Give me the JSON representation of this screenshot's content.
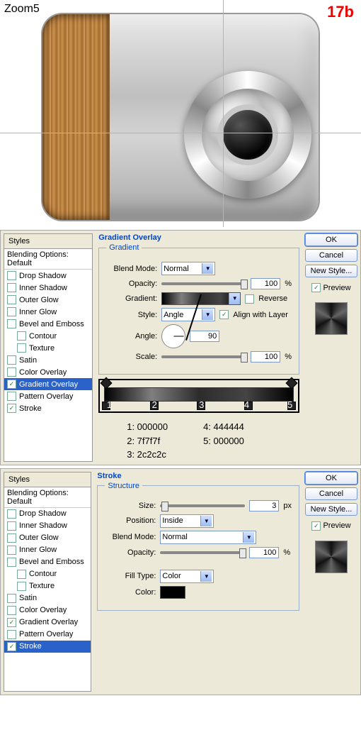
{
  "header": {
    "zoom": "Zoom5",
    "step": "17b"
  },
  "panels": [
    {
      "styles_title": "Styles",
      "blending_options": "Blending Options: Default",
      "style_list": [
        {
          "label": "Drop Shadow",
          "checked": false,
          "indent": false
        },
        {
          "label": "Inner Shadow",
          "checked": false,
          "indent": false
        },
        {
          "label": "Outer Glow",
          "checked": false,
          "indent": false
        },
        {
          "label": "Inner Glow",
          "checked": false,
          "indent": false
        },
        {
          "label": "Bevel and Emboss",
          "checked": false,
          "indent": false
        },
        {
          "label": "Contour",
          "checked": false,
          "indent": true
        },
        {
          "label": "Texture",
          "checked": false,
          "indent": true
        },
        {
          "label": "Satin",
          "checked": false,
          "indent": false
        },
        {
          "label": "Color Overlay",
          "checked": false,
          "indent": false
        },
        {
          "label": "Gradient Overlay",
          "checked": true,
          "indent": false,
          "selected": true
        },
        {
          "label": "Pattern Overlay",
          "checked": false,
          "indent": false
        },
        {
          "label": "Stroke",
          "checked": true,
          "indent": false
        }
      ],
      "section": "Gradient Overlay",
      "group": "Gradient",
      "fields": {
        "blend_mode_label": "Blend Mode:",
        "blend_mode": "Normal",
        "opacity_label": "Opacity:",
        "opacity": "100",
        "pct": "%",
        "gradient_label": "Gradient:",
        "reverse_label": "Reverse",
        "style_label": "Style:",
        "style": "Angle",
        "align_label": "Align with Layer",
        "angle_label": "Angle:",
        "angle": "90",
        "scale_label": "Scale:",
        "scale": "100"
      },
      "editor_numbers": [
        "1",
        "2",
        "3",
        "4",
        "5"
      ],
      "stop_colors": {
        "s1": "1: 000000",
        "s2": "2: 7f7f7f",
        "s3": "3: 2c2c2c",
        "s4": "4: 444444",
        "s5": "5: 000000"
      },
      "buttons": {
        "ok": "OK",
        "cancel": "Cancel",
        "new_style": "New Style...",
        "preview": "Preview"
      }
    },
    {
      "styles_title": "Styles",
      "blending_options": "Blending Options: Default",
      "style_list": [
        {
          "label": "Drop Shadow",
          "checked": false,
          "indent": false
        },
        {
          "label": "Inner Shadow",
          "checked": false,
          "indent": false
        },
        {
          "label": "Outer Glow",
          "checked": false,
          "indent": false
        },
        {
          "label": "Inner Glow",
          "checked": false,
          "indent": false
        },
        {
          "label": "Bevel and Emboss",
          "checked": false,
          "indent": false
        },
        {
          "label": "Contour",
          "checked": false,
          "indent": true
        },
        {
          "label": "Texture",
          "checked": false,
          "indent": true
        },
        {
          "label": "Satin",
          "checked": false,
          "indent": false
        },
        {
          "label": "Color Overlay",
          "checked": false,
          "indent": false
        },
        {
          "label": "Gradient Overlay",
          "checked": true,
          "indent": false
        },
        {
          "label": "Pattern Overlay",
          "checked": false,
          "indent": false
        },
        {
          "label": "Stroke",
          "checked": true,
          "indent": false,
          "selected": true
        }
      ],
      "section": "Stroke",
      "group": "Structure",
      "fields": {
        "size_label": "Size:",
        "size": "3",
        "px": "px",
        "position_label": "Position:",
        "position": "Inside",
        "blend_mode_label": "Blend Mode:",
        "blend_mode": "Normal",
        "opacity_label": "Opacity:",
        "opacity": "100",
        "pct": "%",
        "filltype_label": "Fill Type:",
        "filltype": "Color",
        "color_label": "Color:"
      },
      "buttons": {
        "ok": "OK",
        "cancel": "Cancel",
        "new_style": "New Style...",
        "preview": "Preview"
      }
    }
  ]
}
